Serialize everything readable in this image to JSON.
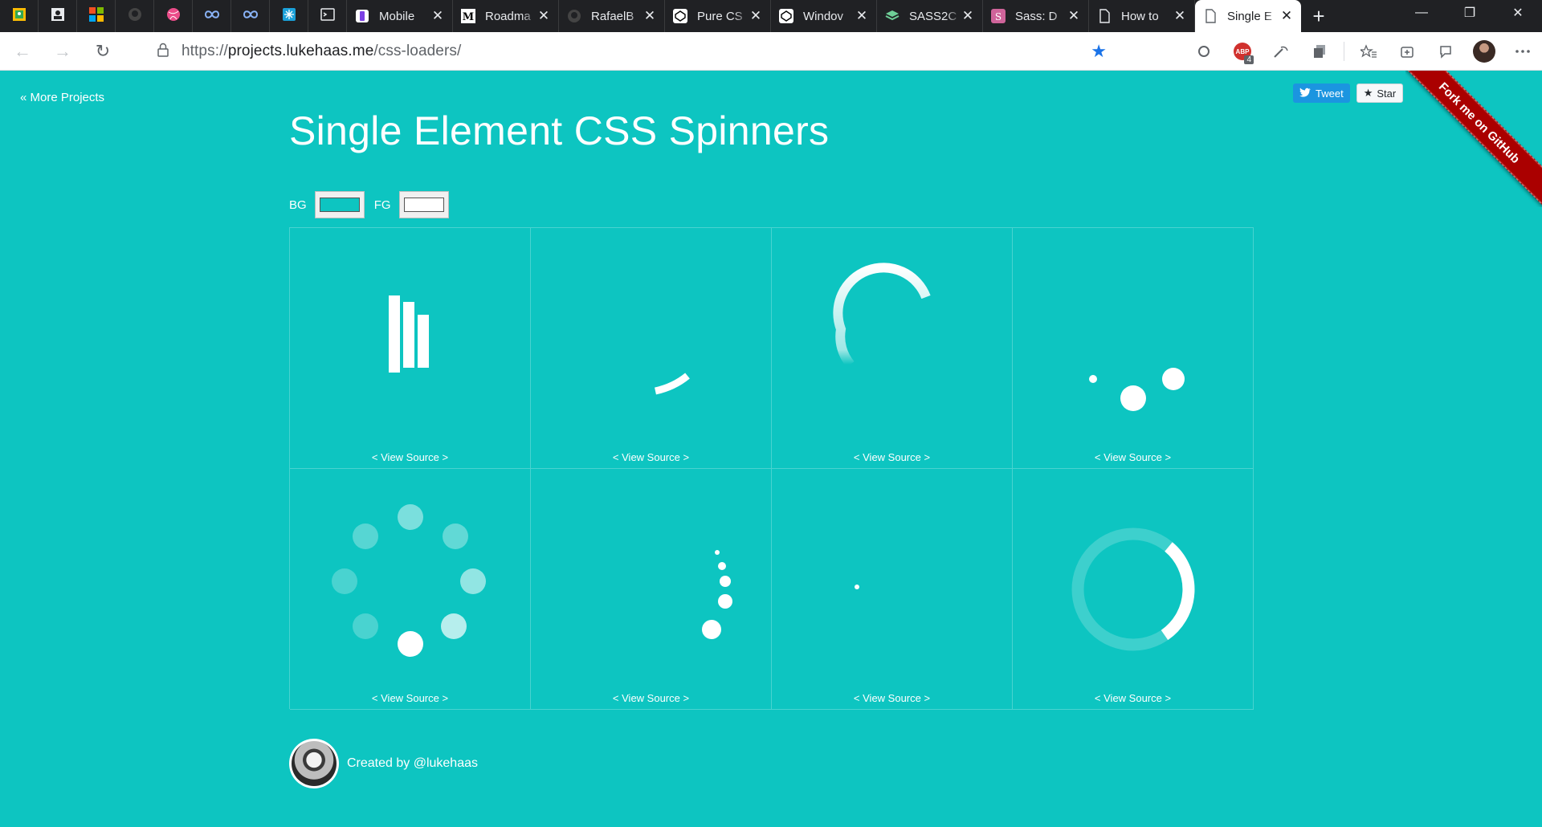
{
  "browser": {
    "pinned_icons": [
      "maps-icon",
      "contacts-icon",
      "microsoft-icon",
      "github-icon",
      "dribbble-icon",
      "infinity-icon",
      "infinity-icon-2",
      "snowflake-icon",
      "terminal-icon"
    ],
    "tabs": [
      {
        "label": "Mobile",
        "icon": "mobile-icon"
      },
      {
        "label": "Roadma",
        "icon": "medium-icon"
      },
      {
        "label": "RafaelB",
        "icon": "github-icon"
      },
      {
        "label": "Pure CS",
        "icon": "codepen-icon"
      },
      {
        "label": "Windov",
        "icon": "codepen-icon"
      },
      {
        "label": "SASS2C",
        "icon": "layers-icon"
      },
      {
        "label": "Sass: D",
        "icon": "sass-icon"
      },
      {
        "label": "How to",
        "icon": "page-icon"
      },
      {
        "label": "Single E",
        "icon": "page-icon"
      }
    ],
    "tab_close": "✕",
    "new_tab": "+",
    "url_prefix": "https://",
    "url_host": "projects.lukehaas.me",
    "url_path": "/css-loaders/",
    "abp_count": "4",
    "window_controls": {
      "minimize": "—",
      "maximize": "❐",
      "close": "✕"
    }
  },
  "page": {
    "more_projects": "« More Projects",
    "tweet": "Tweet",
    "star": "Star",
    "ribbon": "Fork me on GitHub",
    "title": "Single Element CSS Spinners",
    "bg_label": "BG",
    "fg_label": "FG",
    "colors": {
      "bg": "#0dc5c1",
      "fg": "#ffffff"
    },
    "loaders": [
      {
        "id": 1,
        "view_source": "< View Source >"
      },
      {
        "id": 2,
        "view_source": "< View Source >"
      },
      {
        "id": 3,
        "view_source": "< View Source >"
      },
      {
        "id": 4,
        "view_source": "< View Source >"
      },
      {
        "id": 5,
        "view_source": "< View Source >"
      },
      {
        "id": 6,
        "view_source": "< View Source >"
      },
      {
        "id": 7,
        "view_source": "< View Source >"
      },
      {
        "id": 8,
        "view_source": "< View Source >"
      }
    ],
    "footer": "Created by @lukehaas"
  }
}
